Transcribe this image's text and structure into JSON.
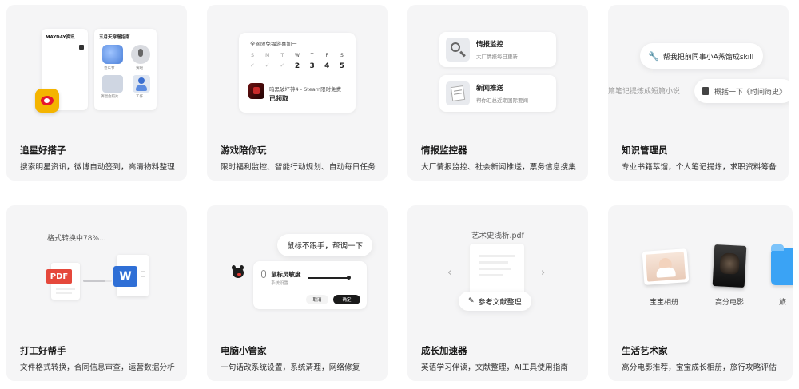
{
  "cards": [
    {
      "title": "追星好搭子",
      "desc": "搜索明星资讯，微博自动签到，高清物料整理",
      "mock": {
        "left_panel_title": "MAYDAY资讯",
        "right_panel_title": "五月天穿搭指南",
        "tiles": [
          "音乐节",
          "演唱",
          "演唱会照片",
          "工作"
        ]
      }
    },
    {
      "title": "游戏陪你玩",
      "desc": "限时福利监控、智能行动规划、自动每日任务",
      "mock": {
        "header": "全网限免福游喜加一",
        "weekdays": [
          "S",
          "M",
          "T",
          "W",
          "T",
          "F",
          "S"
        ],
        "dates": [
          "",
          "",
          "",
          "2",
          "3",
          "4",
          "5"
        ],
        "game_line": "暗黑破坏神4 - Steam限时免费",
        "status": "已领取"
      }
    },
    {
      "title": "情报监控器",
      "desc": "大厂情报监控、社会新闻推送，票务信息搜集",
      "mock": {
        "items": [
          {
            "title": "情报监控",
            "sub": "大厂情报每日更新"
          },
          {
            "title": "新闻推送",
            "sub": "帮你汇总近期国际要闻"
          }
        ]
      }
    },
    {
      "title": "知识管理员",
      "desc": "专业书籍萃馏，个人笔记提炼，求职资料筹备",
      "mock": {
        "pill_top": "帮我把前同事小A蒸馏成skill",
        "pill_left": "篇笔记提炼成短篇小说",
        "pill_right": "概括一下《时间简史》"
      }
    },
    {
      "title": "打工好帮手",
      "desc": "文件格式转换，合同信息审查，运营数据分析",
      "mock": {
        "progress_text": "格式转换中78%...",
        "progress": 0.78,
        "from_label": "PDF",
        "to_label": "W"
      }
    },
    {
      "title": "电脑小管家",
      "desc": "一句话改系统设置，系统清理，网络修复",
      "mock": {
        "bubble": "鼠标不跟手，帮调一下",
        "setting_title": "鼠标灵敏度",
        "setting_sub": "系统设置",
        "cancel_label": "取消",
        "confirm_label": "确定"
      }
    },
    {
      "title": "成长加速器",
      "desc": "英语学习伴读，文献整理，AI工具使用指南",
      "mock": {
        "file_name": "艺术史浅析.pdf",
        "chip": "参考文献整理"
      }
    },
    {
      "title": "生活艺术家",
      "desc": "高分电影推荐，宝宝成长相册，旅行攻略评估",
      "mock": {
        "items": [
          "宝宝相册",
          "高分电影",
          "旅"
        ]
      }
    }
  ],
  "colors": {
    "card_bg": "#f5f5f6",
    "pdf_red": "#e5483b",
    "word_blue": "#2f6fd6",
    "folder_blue": "#3aa3f5",
    "weibo_yellow": "#f4b400"
  }
}
